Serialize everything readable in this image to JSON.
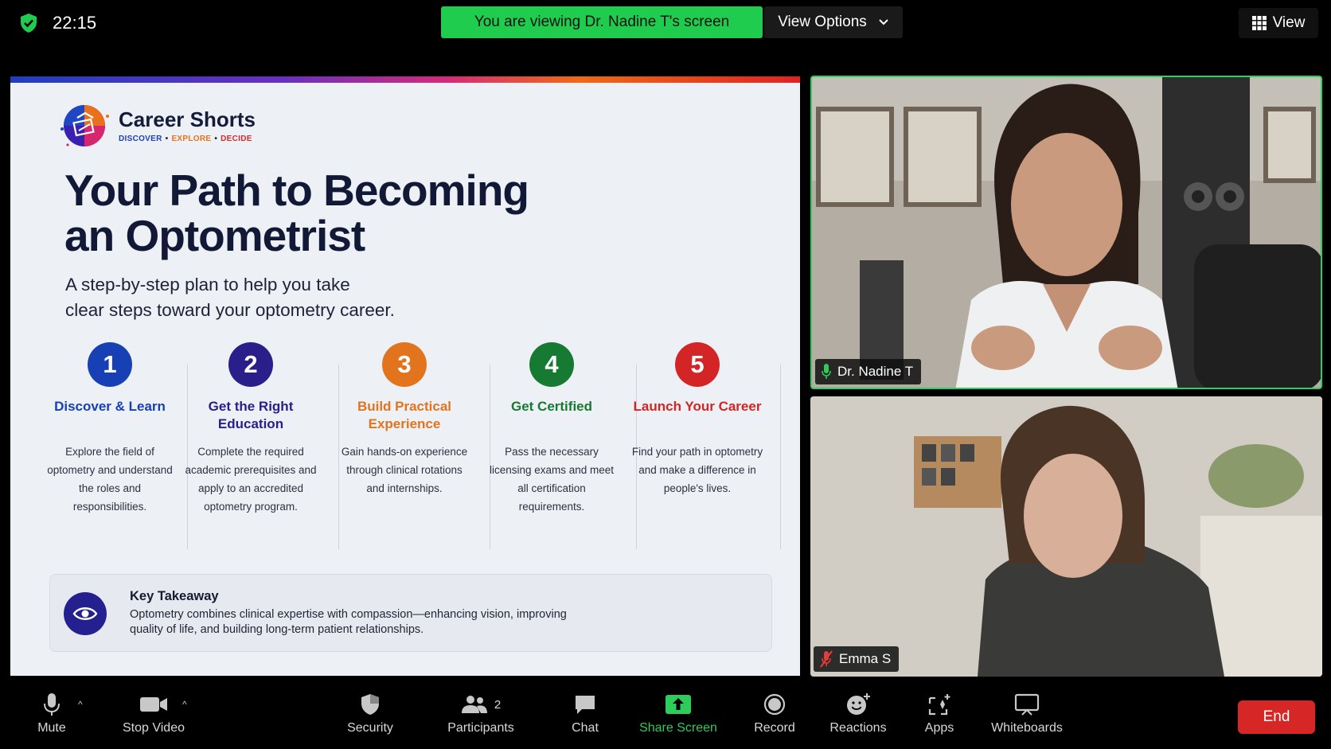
{
  "topbar": {
    "time": "22:15",
    "share_banner": "You are viewing Dr. Nadine T's screen",
    "view_options": "View Options",
    "view": "View"
  },
  "slide": {
    "brand_name": "Career Shorts",
    "brand_tag": [
      "DISCOVER",
      "EXPLORE",
      "DECIDE"
    ],
    "title_line1": "Your Path to Becoming",
    "title_line2": "an Optometrist",
    "subtitle_line1": "A step-by-step plan to help you take",
    "subtitle_line2": "clear steps toward your optometry career.",
    "steps": [
      {
        "num": "1",
        "title": "Discover & Learn",
        "desc": "Explore the field of optometry and understand the roles and responsibilities.",
        "color": "#1740b5"
      },
      {
        "num": "2",
        "title": "Get the Right Education",
        "desc": "Complete the required academic prerequisites and apply to an accredited optometry program.",
        "color": "#2a1f8a"
      },
      {
        "num": "3",
        "title": "Build Practical Experience",
        "desc": "Gain hands-on experience through clinical rotations and internships.",
        "color": "#e2741e"
      },
      {
        "num": "4",
        "title": "Get Certified",
        "desc": "Pass the necessary licensing exams and meet all certification requirements.",
        "color": "#167a32"
      },
      {
        "num": "5",
        "title": "Launch Your Career",
        "desc": "Find your path in optometry and make a difference in people's lives.",
        "color": "#d32525"
      }
    ],
    "takeaway_title": "Key Takeaway",
    "takeaway_text": "Optometry combines clinical expertise with compassion—enhancing vision, improving quality of life, and building long-term patient relationships."
  },
  "participants": [
    {
      "name": "Dr. Nadine T",
      "muted": false
    },
    {
      "name": "Emma S",
      "muted": true
    }
  ],
  "toolbar": {
    "mute": "Mute",
    "stop_video": "Stop Video",
    "security": "Security",
    "participants": "Participants",
    "participants_count": "2",
    "chat": "Chat",
    "share_screen": "Share Screen",
    "record": "Record",
    "reactions": "Reactions",
    "apps": "Apps",
    "whiteboards": "Whiteboards",
    "end": "End"
  },
  "colors": {
    "share_green": "#1fcc4e",
    "end_red": "#d72626",
    "speaker_border": "#2bd15a"
  }
}
